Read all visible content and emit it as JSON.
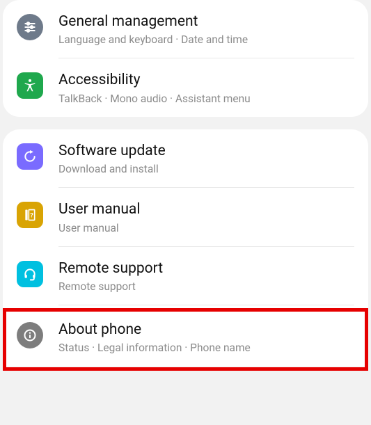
{
  "group1": {
    "general": {
      "title": "General management",
      "subtitle": "Language and keyboard  ·  Date and time"
    },
    "accessibility": {
      "title": "Accessibility",
      "subtitle": "TalkBack  ·  Mono audio  ·  Assistant menu"
    }
  },
  "group2": {
    "software": {
      "title": "Software update",
      "subtitle": "Download and install"
    },
    "manual": {
      "title": "User manual",
      "subtitle": "User manual"
    },
    "remote": {
      "title": "Remote support",
      "subtitle": "Remote support"
    },
    "about": {
      "title": "About phone",
      "subtitle": "Status  ·  Legal information  ·  Phone name"
    }
  }
}
